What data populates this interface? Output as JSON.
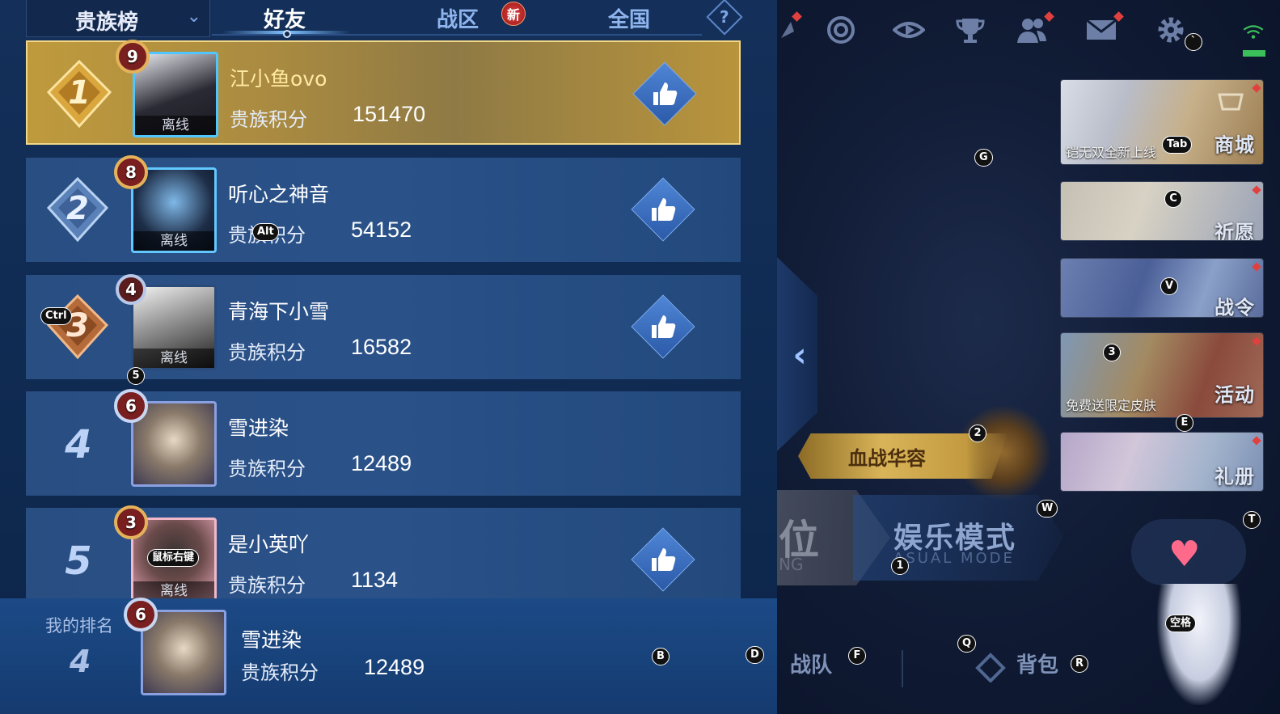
{
  "leaderboard": {
    "dropdown_label": "贵族榜",
    "tabs": [
      {
        "label": "好友"
      },
      {
        "label": "战区"
      },
      {
        "label": "全国"
      }
    ],
    "new_badge": "新",
    "help_label": "?",
    "score_label": "贵族积分",
    "offline_label": "离线",
    "rows": [
      {
        "rank": "1",
        "level": "9",
        "name": "江小鱼ovo",
        "score": "151470"
      },
      {
        "rank": "2",
        "level": "8",
        "name": "听心之神音",
        "score": "54152"
      },
      {
        "rank": "3",
        "level": "4",
        "name": "青海下小雪",
        "score": "16582"
      },
      {
        "rank": "4",
        "level": "6",
        "name": "雪进染",
        "score": "12489"
      },
      {
        "rank": "5",
        "level": "3",
        "name": "是小英吖",
        "score": "1134"
      }
    ],
    "my_rank": {
      "label": "我的排名",
      "rank": "4",
      "level": "6",
      "name": "雪进染",
      "score": "12489"
    }
  },
  "side_menu": {
    "shop": {
      "label": "商城",
      "caption": "铠无双全新上线"
    },
    "wish": {
      "label": "祈愿"
    },
    "battle_pass": {
      "label": "战令"
    },
    "events": {
      "label": "活动",
      "caption": "免费送限定皮肤"
    },
    "gift_book": {
      "label": "礼册"
    }
  },
  "main": {
    "event_banner": "血战华容",
    "ranked_mode": {
      "title": "位",
      "subtitle": "NG"
    },
    "casual_mode": {
      "title": "娱乐模式",
      "subtitle": "ASUAL MODE"
    },
    "team": "战队",
    "backpack": "背包"
  },
  "hotkeys": {
    "tab": "Tab",
    "g": "G",
    "c": "C",
    "v": "V",
    "k3": "3",
    "e": "E",
    "k2": "2",
    "w": "W",
    "t": "T",
    "k1": "1",
    "space": "空格",
    "q": "Q",
    "r": "R",
    "f": "F",
    "b": "B",
    "d": "D",
    "alt": "Alt",
    "ctrl": "Ctrl",
    "k5": "5",
    "rmb": "鼠标右键",
    "backtick": "`"
  },
  "colors": {
    "gold_row": "#bf9a3d",
    "row_blue": "#294e82",
    "accent": "#7fc0ff",
    "red_dot": "#e0413f"
  }
}
